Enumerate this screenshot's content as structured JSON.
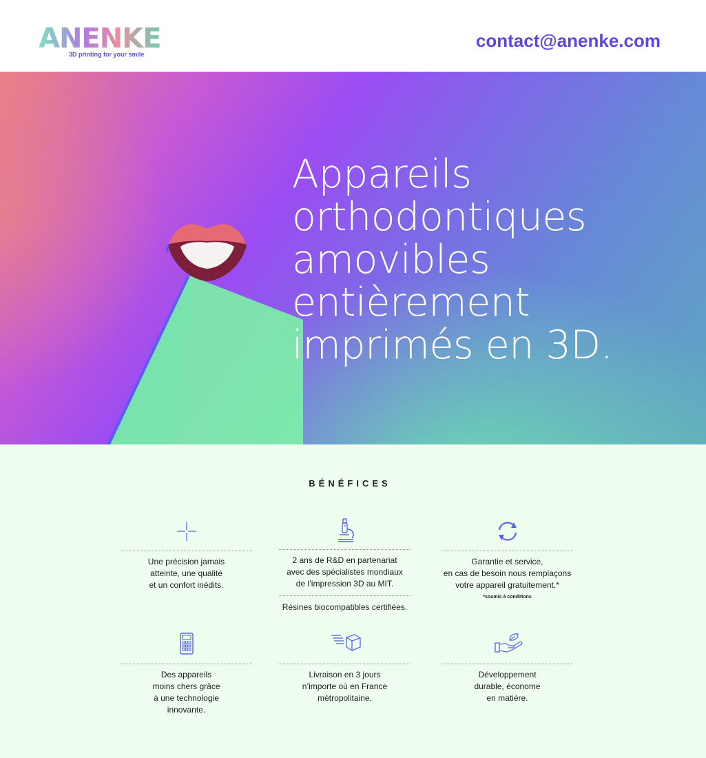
{
  "header": {
    "brand": "ANENKE",
    "tagline": "3D printing for your smile",
    "contact_email": "contact@anenke.com"
  },
  "hero": {
    "title": "Appareils orthodontiques amovibles entièrement imprimés en 3D."
  },
  "benefits": {
    "title": "BÉNÉFICES",
    "items": [
      {
        "icon": "crosshair-icon",
        "text": "Une précision jamais\natteinte, une qualité\net un confort inédits."
      },
      {
        "icon": "microscope-icon",
        "text": "2 ans de R&D en partenariat\navec des spécialistes mondiaux\nde l’impression 3D au MIT.",
        "extra": "Résines biocompatibles certifiées."
      },
      {
        "icon": "refresh-icon",
        "text": "Garantie et service,\nen cas de besoin nous remplaçons\nvotre appareil gratuitement.*",
        "note": "*soumis à conditions"
      },
      {
        "icon": "calculator-icon",
        "text": "Des appareils\nmoins chers grâce\nà une technologie\ninnovante."
      },
      {
        "icon": "delivery-box-icon",
        "text": "Livraison en 3 jours\nn’importe où en France\nmétropolitaine."
      },
      {
        "icon": "hand-leaf-icon",
        "text": "Développement\ndurable, économe\nen matière."
      }
    ]
  },
  "colors": {
    "accent": "#5a48e6",
    "benefits_bg": "#eefdf0",
    "icon": "#5566e8"
  }
}
